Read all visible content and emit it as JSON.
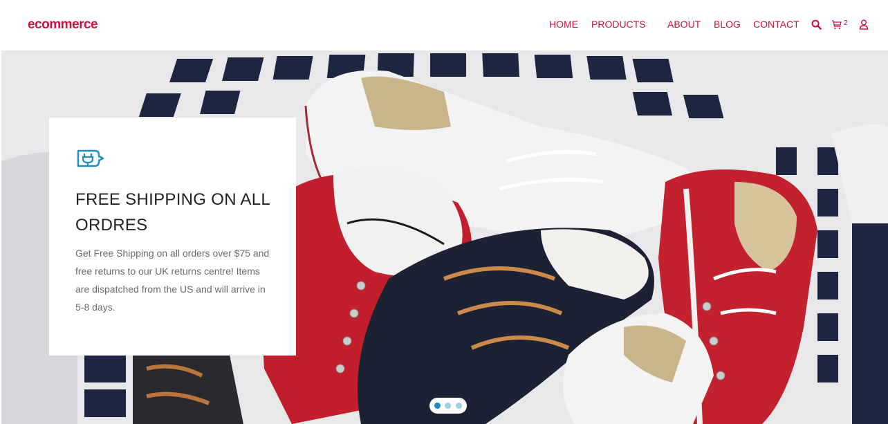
{
  "header": {
    "logo": "ecommerce",
    "nav": {
      "home": "HOME",
      "products": "PRODUCTS",
      "about": "ABOUT",
      "blog": "BLOG",
      "contact": "CONTACT"
    },
    "cart_count": "2",
    "icons": [
      "search-icon",
      "cart-icon",
      "user-icon"
    ]
  },
  "hero": {
    "image": "sneakers-in-laundry-basket",
    "card": {
      "icon": "plug-icon",
      "title": "FREE SHIPPING ON ALL ORDRES",
      "text": "Get Free Shipping on all orders over $75 and free returns to our UK returns centre! Items are dispatched from the US and will arrive in 5-8 days."
    },
    "slider": {
      "slides": 3,
      "active": 1
    }
  },
  "colors": {
    "accent": "#d1103a",
    "icon_blue": "#1f8cbf"
  }
}
